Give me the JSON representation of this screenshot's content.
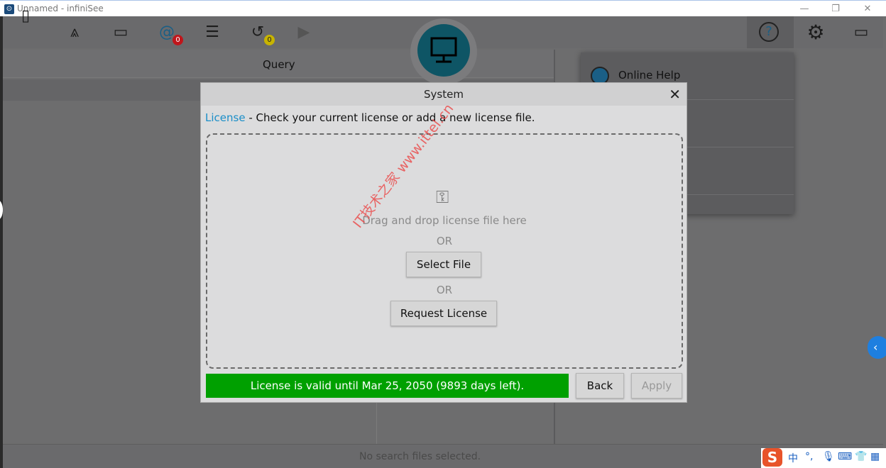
{
  "window": {
    "title": "Unnamed - infiniSee",
    "controls": {
      "minimize": "—",
      "maximize": "❐",
      "close": "✕"
    }
  },
  "toolbar": {
    "items": [
      {
        "icon": "document-icon"
      },
      {
        "icon": "compass-icon"
      },
      {
        "icon": "id-card-icon"
      },
      {
        "icon": "spiral-icon",
        "badge": "0",
        "badge_color": "#c0161b"
      },
      {
        "icon": "sliders-icon"
      },
      {
        "icon": "history-icon",
        "badge": "0",
        "badge_color": "#c8b400"
      },
      {
        "icon": "play-icon"
      }
    ],
    "right": [
      {
        "icon": "help-icon"
      },
      {
        "icon": "gear-icon"
      },
      {
        "icon": "monitor-settings-icon"
      }
    ]
  },
  "panel": {
    "query_header": "Query",
    "status": "No search files selected."
  },
  "help_menu": {
    "items": [
      {
        "label": "Online Help",
        "icon": "globe-icon"
      }
    ]
  },
  "dialog": {
    "title": "System",
    "section": "License",
    "separator": "-",
    "description": "Check your current license or add a new license file.",
    "drop_text": "Drag and drop license file here",
    "or1": "OR",
    "select_file": "Select File",
    "or2": "OR",
    "request_license": "Request License",
    "license_status": "License is valid until Mar 25, 2050 (9893 days left).",
    "back": "Back",
    "apply": "Apply"
  },
  "watermark": "IT技术之家 www.ittel.cn",
  "colors": {
    "accent": "#1a8ec8",
    "valid": "#00a000",
    "teal": "#0e5565"
  }
}
